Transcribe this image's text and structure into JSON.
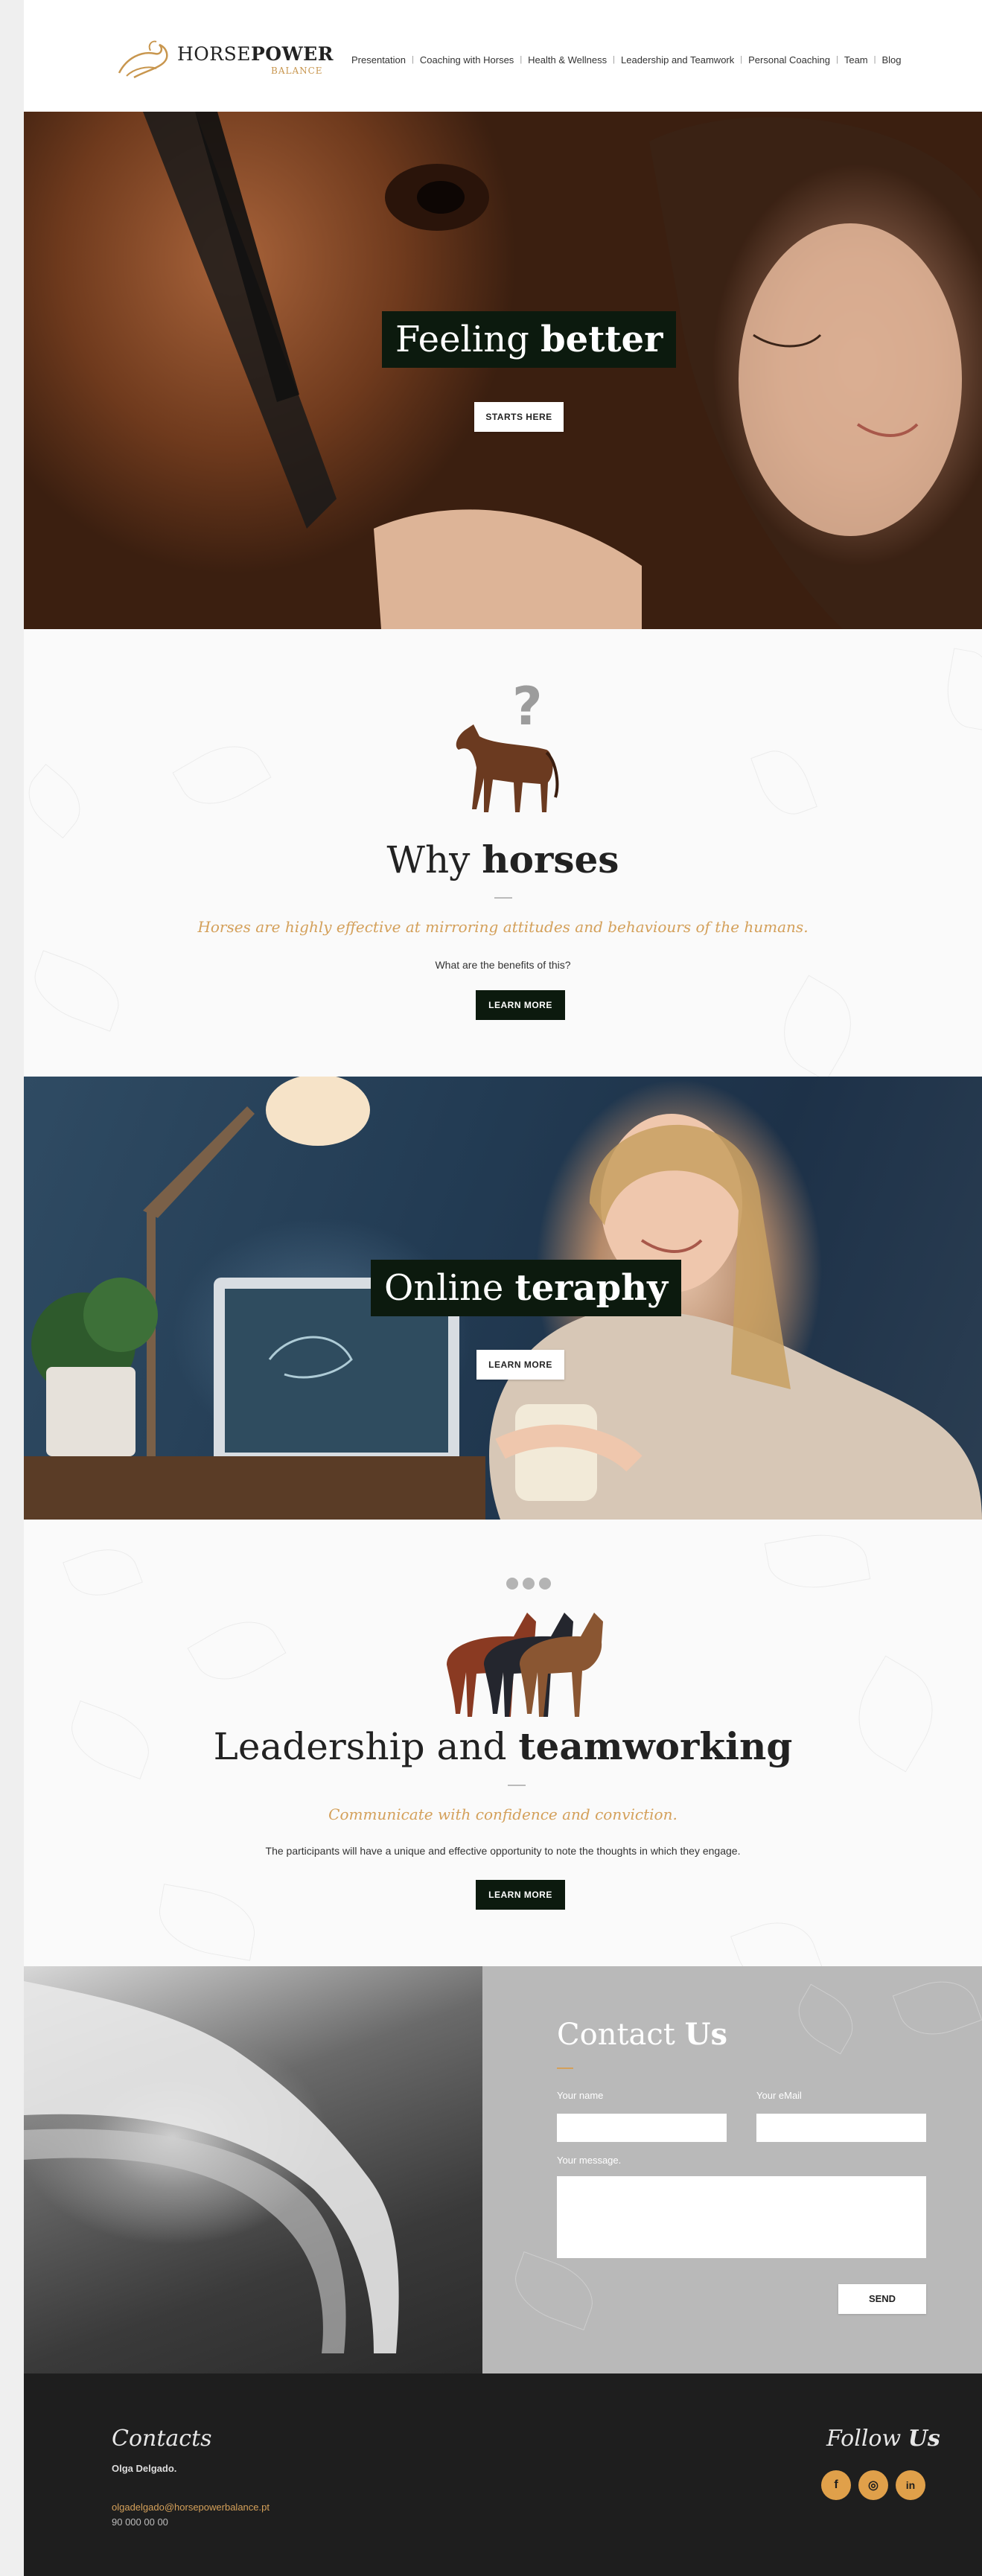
{
  "brand": {
    "name_light": "HORSE",
    "name_bold": "POWER",
    "sub": "BALANCE"
  },
  "nav": {
    "items": [
      {
        "label": "Presentation"
      },
      {
        "label": "Coaching with Horses"
      },
      {
        "label": "Health & Wellness"
      },
      {
        "label": "Leadership and Teamwork"
      },
      {
        "label": "Personal Coaching"
      },
      {
        "label": "Team"
      },
      {
        "label": "Blog"
      }
    ]
  },
  "hero1": {
    "title_light": "Feeling ",
    "title_bold": "better",
    "button": "STARTS HERE"
  },
  "why": {
    "title_light": "Why ",
    "title_bold": "horses",
    "tagline": "Horses are highly effective at mirroring attitudes and behaviours of the humans.",
    "desc": "What are the benefits of this?",
    "button": "LEARN MORE"
  },
  "hero2": {
    "title_light": "Online ",
    "title_bold": "teraphy",
    "button": "LEARN MORE"
  },
  "leadership": {
    "title_light": "Leadership and ",
    "title_bold": "teamworking",
    "tagline": "Communicate with confidence and conviction.",
    "desc": "The participants will have a unique and effective opportunity to note the thoughts in which they engage.",
    "button": "LEARN MORE"
  },
  "contact": {
    "title_light": "Contact ",
    "title_bold": "Us",
    "name_label": "Your name",
    "email_label": "Your eMail",
    "message_label": "Your message.",
    "send": "SEND"
  },
  "footer": {
    "contacts_title": "Contacts",
    "person": "Olga Delgado.",
    "email": "olgadelgado@horsepowerbalance.pt",
    "phone": "90 000 00 00",
    "follow_light": "Follow ",
    "follow_bold": "Us",
    "social": [
      {
        "icon": "facebook-icon",
        "glyph": "f"
      },
      {
        "icon": "instagram-icon",
        "glyph": "◎"
      },
      {
        "icon": "linkedin-icon",
        "glyph": "in"
      }
    ]
  },
  "colors": {
    "accent": "#d4a05a",
    "dark_button": "#0c1a0e",
    "footer_bg": "#1e1e1e",
    "contact_bg": "#b9b9b9"
  }
}
